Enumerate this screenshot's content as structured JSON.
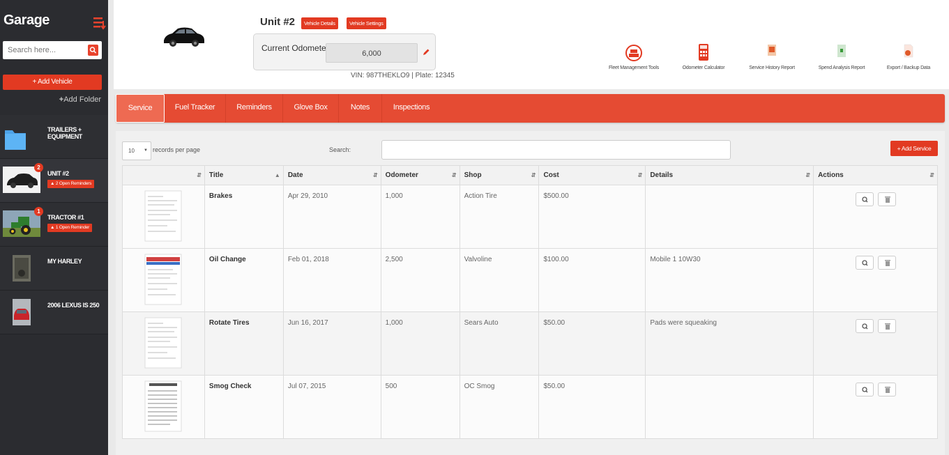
{
  "sidebar": {
    "title": "Garage",
    "search_placeholder": "Search here...",
    "add_vehicle_label": "+ Add Vehicle",
    "add_folder_label": "Add Folder",
    "items": [
      {
        "name": "TRAILERS + EQUIPMENT",
        "thumb": "folder-icon"
      },
      {
        "name": "UNIT #2",
        "badge": "2",
        "reminder": "2 Open Reminders",
        "thumb": "car-thumbnail"
      },
      {
        "name": "TRACTOR #1",
        "badge": "1",
        "reminder": "1 Open Reminder",
        "thumb": "tractor-thumbnail"
      },
      {
        "name": "MY HARLEY",
        "thumb": "motorcycle-thumbnail"
      },
      {
        "name": "2006 LEXUS IS 250",
        "thumb": "red-car-thumbnail"
      }
    ]
  },
  "header": {
    "unit_title": "Unit #2",
    "vehicle_details_label": "Vehicle Details",
    "vehicle_settings_label": "Vehicle Settings",
    "odometer_label": "Current Odometer",
    "odometer_value": "6,000",
    "vin_plate": "VIN: 987THEKLO9 | Plate: 12345",
    "tools": [
      {
        "label": "Fleet Management Tools",
        "icon": "fleet-tools-icon"
      },
      {
        "label": "Odometer Calculator",
        "icon": "calculator-icon"
      },
      {
        "label": "Service History Report",
        "icon": "service-report-icon"
      },
      {
        "label": "Spend Analysis Report",
        "icon": "spend-report-icon"
      },
      {
        "label": "Export / Backup Data",
        "icon": "export-icon"
      }
    ]
  },
  "tabs": [
    {
      "label": "Service",
      "active": true
    },
    {
      "label": "Fuel Tracker"
    },
    {
      "label": "Reminders"
    },
    {
      "label": "Glove Box"
    },
    {
      "label": "Notes"
    },
    {
      "label": "Inspections"
    }
  ],
  "table_controls": {
    "per_page_value": "10",
    "per_page_label": "records per page",
    "search_label": "Search:",
    "add_service_label": "+ Add Service"
  },
  "table": {
    "columns": [
      "",
      "Title",
      "Date",
      "Odometer",
      "Shop",
      "Cost",
      "Details",
      "Actions"
    ],
    "rows": [
      {
        "title": "Brakes",
        "date": "Apr 29, 2010",
        "odometer": "1,000",
        "shop": "Action Tire",
        "cost": "$500.00",
        "details": ""
      },
      {
        "title": "Oil Change",
        "date": "Feb 01, 2018",
        "odometer": "2,500",
        "shop": "Valvoline",
        "cost": "$100.00",
        "details": "Mobile 1 10W30"
      },
      {
        "title": "Rotate Tires",
        "date": "Jun 16, 2017",
        "odometer": "1,000",
        "shop": "Sears Auto",
        "cost": "$50.00",
        "details": "Pads were squeaking"
      },
      {
        "title": "Smog Check",
        "date": "Jul 07, 2015",
        "odometer": "500",
        "shop": "OC Smog",
        "cost": "$50.00",
        "details": ""
      }
    ]
  },
  "colors": {
    "accent": "#e23a22",
    "tabbar": "#e54b33",
    "sidebar": "#2b2c30"
  }
}
